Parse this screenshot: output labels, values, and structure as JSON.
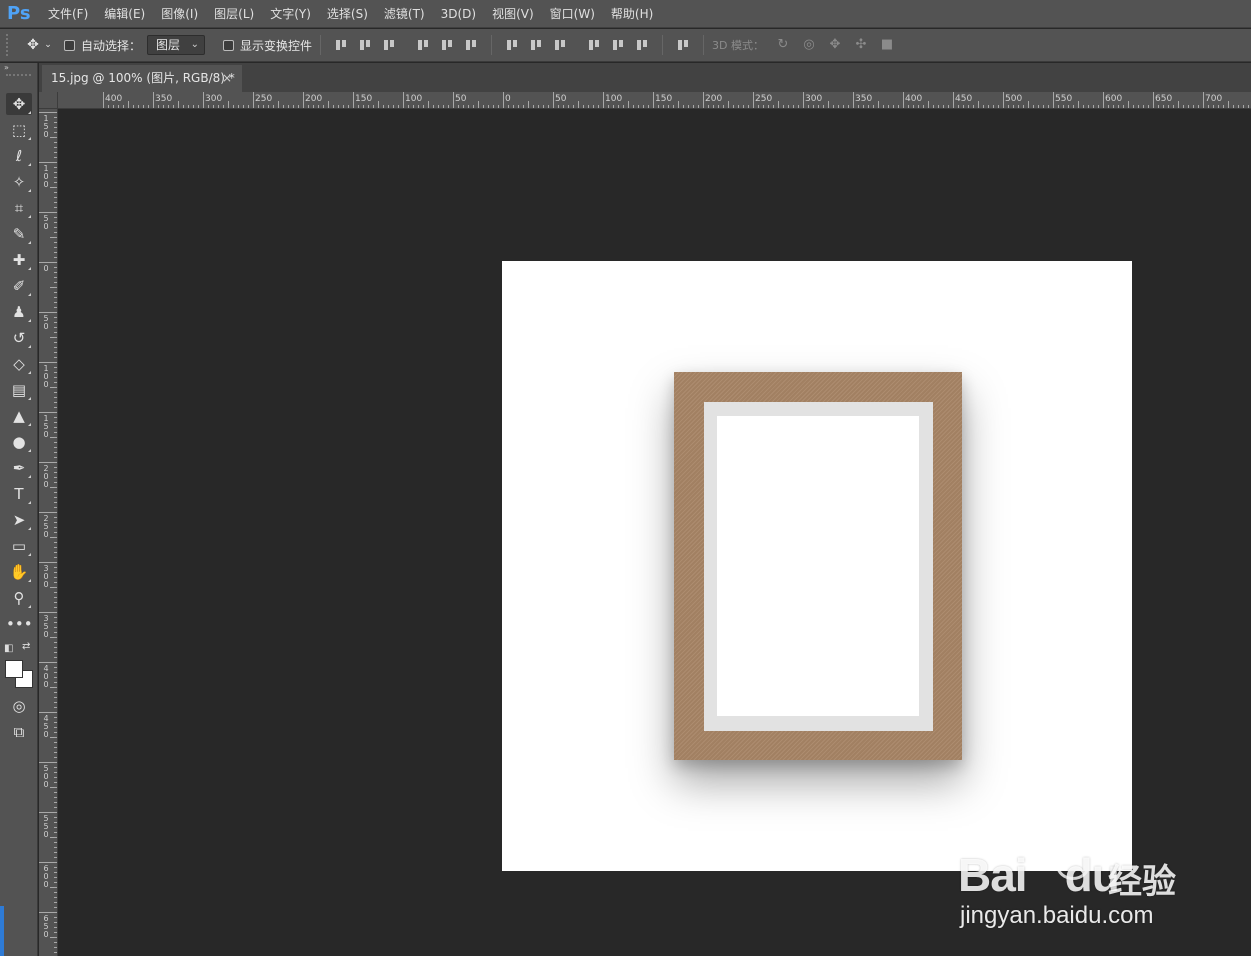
{
  "app": {
    "logo": "Ps"
  },
  "menu": [
    "文件(F)",
    "编辑(E)",
    "图像(I)",
    "图层(L)",
    "文字(Y)",
    "选择(S)",
    "滤镜(T)",
    "3D(D)",
    "视图(V)",
    "窗口(W)",
    "帮助(H)"
  ],
  "options": {
    "auto_select_label": "自动选择：",
    "auto_select_value": "图层",
    "show_transform_label": "显示变换控件",
    "mode_3d_label": "3D 模式："
  },
  "toolbar": {
    "collapse_glyph": "»",
    "tools": [
      {
        "name": "move-tool",
        "glyph": "✥"
      },
      {
        "name": "marquee-tool",
        "glyph": "⬚"
      },
      {
        "name": "lasso-tool",
        "glyph": "ℓ"
      },
      {
        "name": "magic-wand-tool",
        "glyph": "✧"
      },
      {
        "name": "crop-tool",
        "glyph": "⌗"
      },
      {
        "name": "eyedropper-tool",
        "glyph": "✎"
      },
      {
        "name": "healing-brush-tool",
        "glyph": "✚"
      },
      {
        "name": "brush-tool",
        "glyph": "✐"
      },
      {
        "name": "clone-stamp-tool",
        "glyph": "♟"
      },
      {
        "name": "history-brush-tool",
        "glyph": "↺"
      },
      {
        "name": "eraser-tool",
        "glyph": "◇"
      },
      {
        "name": "gradient-tool",
        "glyph": "▤"
      },
      {
        "name": "blur-tool",
        "glyph": "▲"
      },
      {
        "name": "dodge-tool",
        "glyph": "●"
      },
      {
        "name": "pen-tool",
        "glyph": "✒"
      },
      {
        "name": "type-tool",
        "glyph": "T"
      },
      {
        "name": "path-selection-tool",
        "glyph": "➤"
      },
      {
        "name": "rectangle-tool",
        "glyph": "▭"
      },
      {
        "name": "hand-tool",
        "glyph": "✋"
      },
      {
        "name": "zoom-tool",
        "glyph": "⚲"
      },
      {
        "name": "more-tools",
        "glyph": "•••"
      }
    ],
    "quick_mask_glyph": "◎",
    "screen_mode_glyph": "⧉",
    "swap_glyph": "⇄"
  },
  "document": {
    "tab_title": "15.jpg @ 100% (图片, RGB/8) *",
    "close_glyph": "×"
  },
  "rulers": {
    "horizontal_labels": [
      "400",
      "350",
      "300",
      "250",
      "200",
      "150",
      "100",
      "50",
      "0",
      "50",
      "100",
      "150",
      "200",
      "250",
      "300",
      "350",
      "400",
      "450",
      "500",
      "550",
      "600",
      "650",
      "700"
    ],
    "vertical_labels": [
      "150",
      "100",
      "50",
      "0",
      "50",
      "100",
      "150",
      "200",
      "250",
      "300",
      "350",
      "400",
      "450",
      "500",
      "550",
      "600",
      "650"
    ]
  },
  "watermark": {
    "brand": "Bai",
    "brand_tail": "du",
    "brand_cn": "经验",
    "url": "jingyan.baidu.com"
  },
  "colors": {
    "frame": "#a88566",
    "mat": "#e2e2e2",
    "canvas_bg": "#ffffff",
    "workspace": "#282828",
    "ui_panel": "#535353",
    "logo_blue": "#4fa3f7"
  }
}
